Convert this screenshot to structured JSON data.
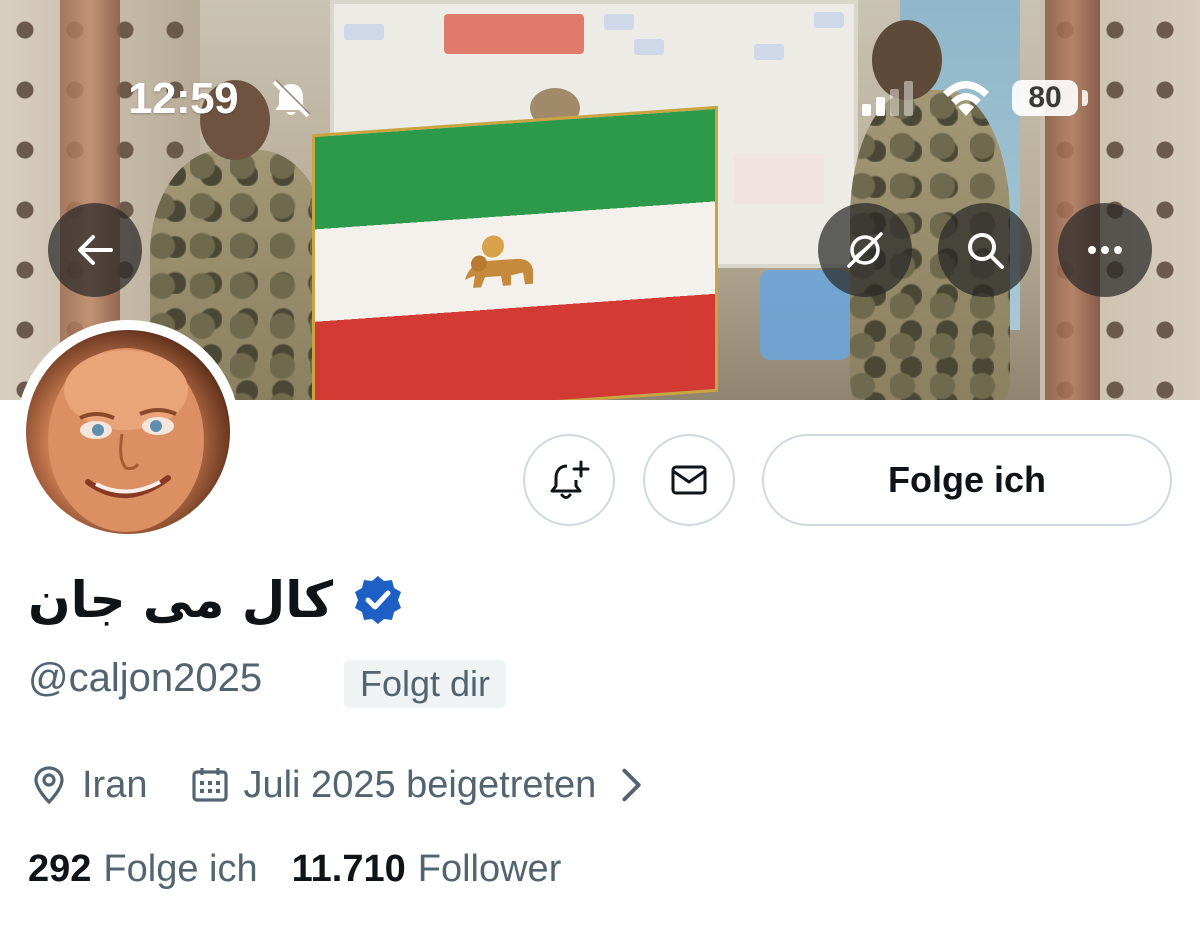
{
  "status_bar": {
    "time": "12:59",
    "battery": "80",
    "icons": [
      "bell-slash-icon",
      "cellular-signal-icon",
      "wifi-icon",
      "battery-icon"
    ]
  },
  "nav": {
    "back_icon": "arrow-left-icon",
    "grok_icon": "grok-icon",
    "search_icon": "search-icon",
    "more_icon": "more-dots-icon"
  },
  "profile": {
    "display_name": "کال می جان",
    "verified_color": "#1d9bf0",
    "handle": "@caljon2025",
    "follows_you_badge": "Folgt dir",
    "location": "Iran",
    "joined": "Juli 2025 beigetreten",
    "following_count": "292",
    "following_label": "Folge ich",
    "followers_count": "11.710",
    "followers_label": "Follower"
  },
  "actions": {
    "notify_icon": "bell-plus-icon",
    "message_icon": "envelope-icon",
    "follow_button_label": "Folge ich"
  },
  "colors": {
    "text_primary": "#0f1419",
    "text_secondary": "#536471",
    "border": "#cfd9de",
    "badge_bg": "#eff3f4",
    "verified_blue": "#1d9bf0"
  }
}
